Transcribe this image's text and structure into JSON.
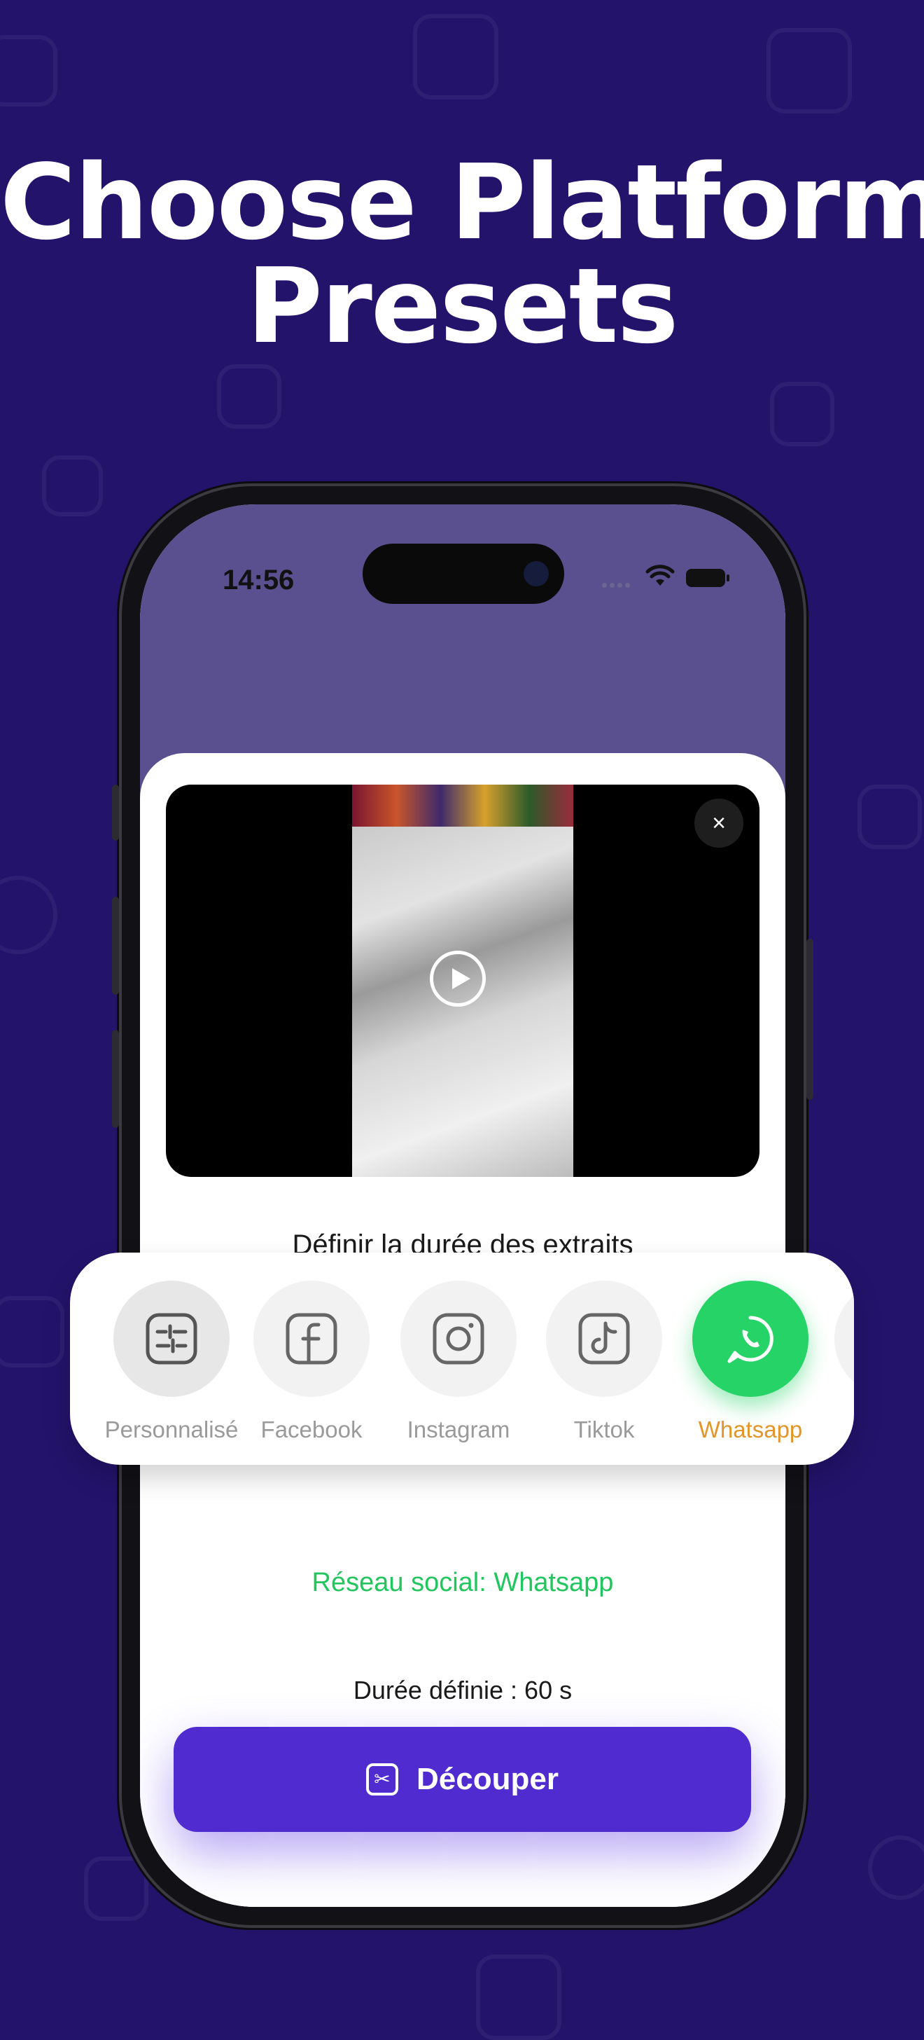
{
  "headline": {
    "line1": "Choose Platform",
    "line2": "Presets"
  },
  "status_bar": {
    "time": "14:56"
  },
  "sheet": {
    "title": "Définir la durée des extraits",
    "network_label": "Réseau social: Whatsapp",
    "duration_label": "Durée définie :  60 s",
    "cut_button": "Découper",
    "close_glyph": "×"
  },
  "presets": [
    {
      "label": "Personnalisé",
      "icon": "sliders-icon",
      "selected": false
    },
    {
      "label": "Facebook",
      "icon": "facebook-icon",
      "selected": false
    },
    {
      "label": "Instagram",
      "icon": "instagram-icon",
      "selected": false
    },
    {
      "label": "Tiktok",
      "icon": "tiktok-icon",
      "selected": false
    },
    {
      "label": "Whatsapp",
      "icon": "whatsapp-icon",
      "selected": true
    }
  ],
  "colors": {
    "background": "#23136b",
    "accent": "#4f2bd0",
    "whatsapp": "#25d366",
    "active_label": "#e0962a",
    "network_text": "#22c55e"
  }
}
